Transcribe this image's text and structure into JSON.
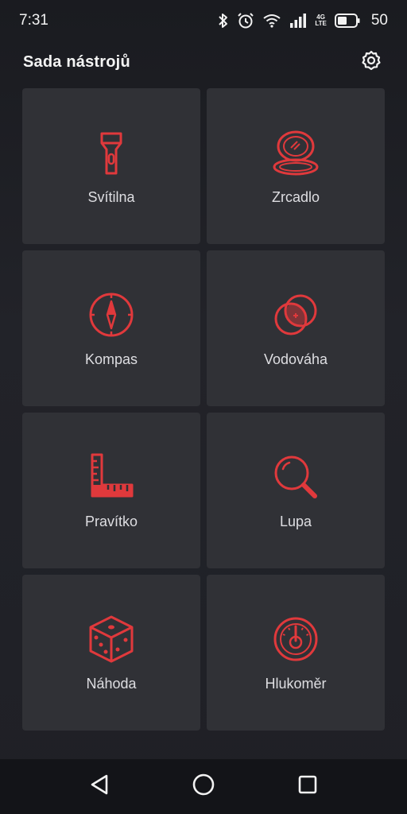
{
  "status_bar": {
    "time": "7:31",
    "network_tag_top": "4G",
    "network_tag_bottom": "LTE",
    "battery_level": "50",
    "icons": [
      "bluetooth-icon",
      "alarm-icon",
      "wifi-icon",
      "signal-icon",
      "battery-icon"
    ]
  },
  "header": {
    "title": "Sada nástrojů",
    "settings_icon": "gear-icon"
  },
  "accent_color": "#e0393c",
  "tiles": [
    {
      "label": "Svítilna",
      "icon": "flashlight-icon"
    },
    {
      "label": "Zrcadlo",
      "icon": "mirror-icon"
    },
    {
      "label": "Kompas",
      "icon": "compass-icon"
    },
    {
      "label": "Vodováha",
      "icon": "level-icon"
    },
    {
      "label": "Pravítko",
      "icon": "ruler-icon"
    },
    {
      "label": "Lupa",
      "icon": "magnifier-icon"
    },
    {
      "label": "Náhoda",
      "icon": "dice-icon"
    },
    {
      "label": "Hlukoměr",
      "icon": "sound-meter-icon"
    }
  ],
  "nav_bar": {
    "icons": [
      "back-icon",
      "home-icon",
      "recents-icon"
    ]
  }
}
